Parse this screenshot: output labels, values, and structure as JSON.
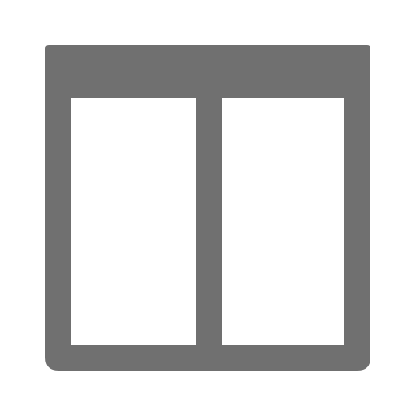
{
  "icon": {
    "name": "two-column-layout-icon",
    "color": "#707070",
    "background": "#ffffff"
  }
}
